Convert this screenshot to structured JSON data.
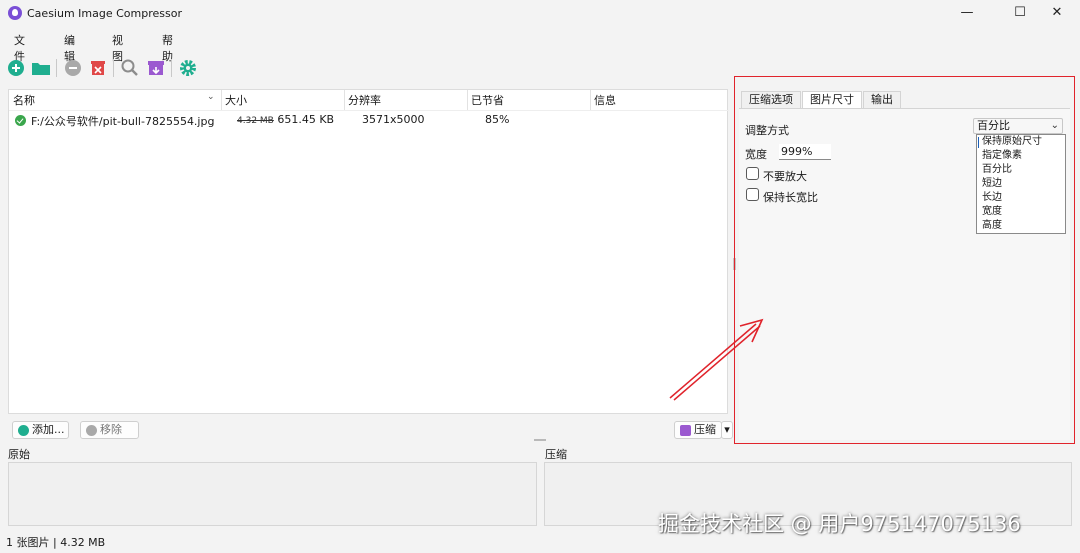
{
  "window": {
    "title": "Caesium Image Compressor",
    "minimize": "—",
    "maximize": "☐",
    "close": "✕"
  },
  "menu": [
    {
      "label": "文件"
    },
    {
      "label": "编辑"
    },
    {
      "label": "视图"
    },
    {
      "label": "帮助"
    }
  ],
  "toolbar": {
    "icons": [
      "add-icon",
      "open-folder-icon",
      "remove-icon",
      "clear-icon",
      "search-icon",
      "compress-icon",
      "settings-icon"
    ]
  },
  "file_list": {
    "columns": [
      "名称",
      "大小",
      "分辨率",
      "已节省",
      "信息"
    ],
    "rows": [
      {
        "name": "F:/公众号软件/pit-bull-7825554.jpg",
        "original_size": "4.32 MB",
        "compressed_size": "651.45 KB",
        "resolution": "3571x5000",
        "saved": "85%",
        "info": ""
      }
    ]
  },
  "buttons": {
    "add": "添加...",
    "remove": "移除",
    "compress": "压缩",
    "compress_arrow": "▾"
  },
  "preview": {
    "original_label": "原始",
    "compressed_label": "压缩"
  },
  "status": "1 张图片 | 4.32 MB",
  "settings": {
    "tabs": [
      {
        "label": "压缩选项"
      },
      {
        "label": "图片尺寸"
      },
      {
        "label": "输出"
      }
    ],
    "resize_mode_label": "调整方式",
    "resize_mode_value": "百分比",
    "resize_options": [
      "保持原始尺寸",
      "指定像素",
      "百分比",
      "短边",
      "长边",
      "宽度",
      "高度"
    ],
    "width_label": "宽度",
    "width_value": "999%",
    "no_upscale_label": "不要放大",
    "keep_aspect_label": "保持长宽比"
  },
  "watermark": "掘金技术社区 @ 用户975147075136",
  "colors": {
    "accent_green": "#1fae8f",
    "accent_purple": "#9b59d0",
    "highlight_red": "#e0232b",
    "check_green": "#3aa64c"
  }
}
